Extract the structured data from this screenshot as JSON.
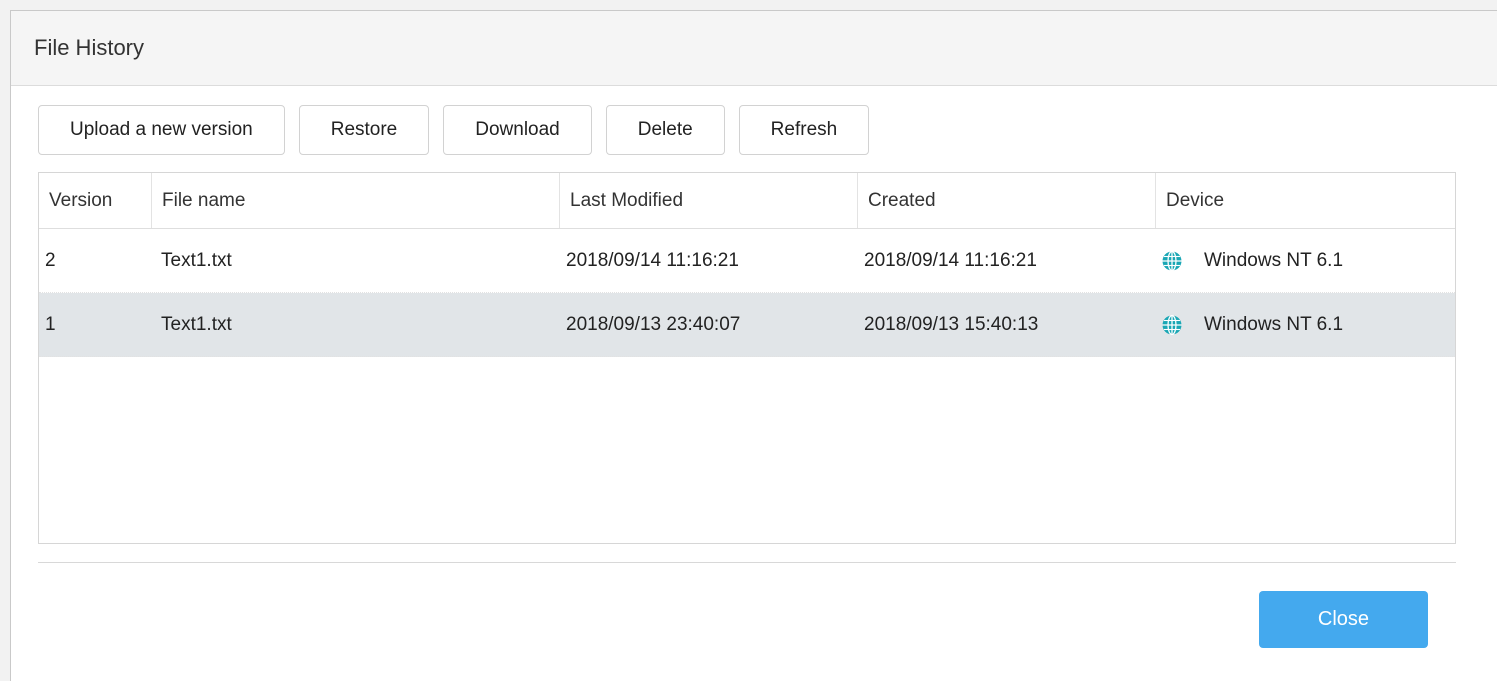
{
  "dialog": {
    "title": "File History"
  },
  "toolbar": {
    "upload_label": "Upload a new version",
    "restore_label": "Restore",
    "download_label": "Download",
    "delete_label": "Delete",
    "refresh_label": "Refresh"
  },
  "table": {
    "headers": {
      "version": "Version",
      "file_name": "File name",
      "last_modified": "Last Modified",
      "created": "Created",
      "device": "Device"
    },
    "rows": [
      {
        "version": "2",
        "file_name": "Text1.txt",
        "last_modified": "2018/09/14 11:16:21",
        "created": "2018/09/14 11:16:21",
        "device": "Windows NT 6.1",
        "device_icon": "globe-icon",
        "selected": false
      },
      {
        "version": "1",
        "file_name": "Text1.txt",
        "last_modified": "2018/09/13 23:40:07",
        "created": "2018/09/13 15:40:13",
        "device": "Windows NT 6.1",
        "device_icon": "globe-icon",
        "selected": true
      }
    ]
  },
  "footer": {
    "close_label": "Close"
  },
  "colors": {
    "accent": "#44a9ee",
    "selected_row": "#e1e5e8",
    "globe_icon": "#1aa7b5"
  }
}
